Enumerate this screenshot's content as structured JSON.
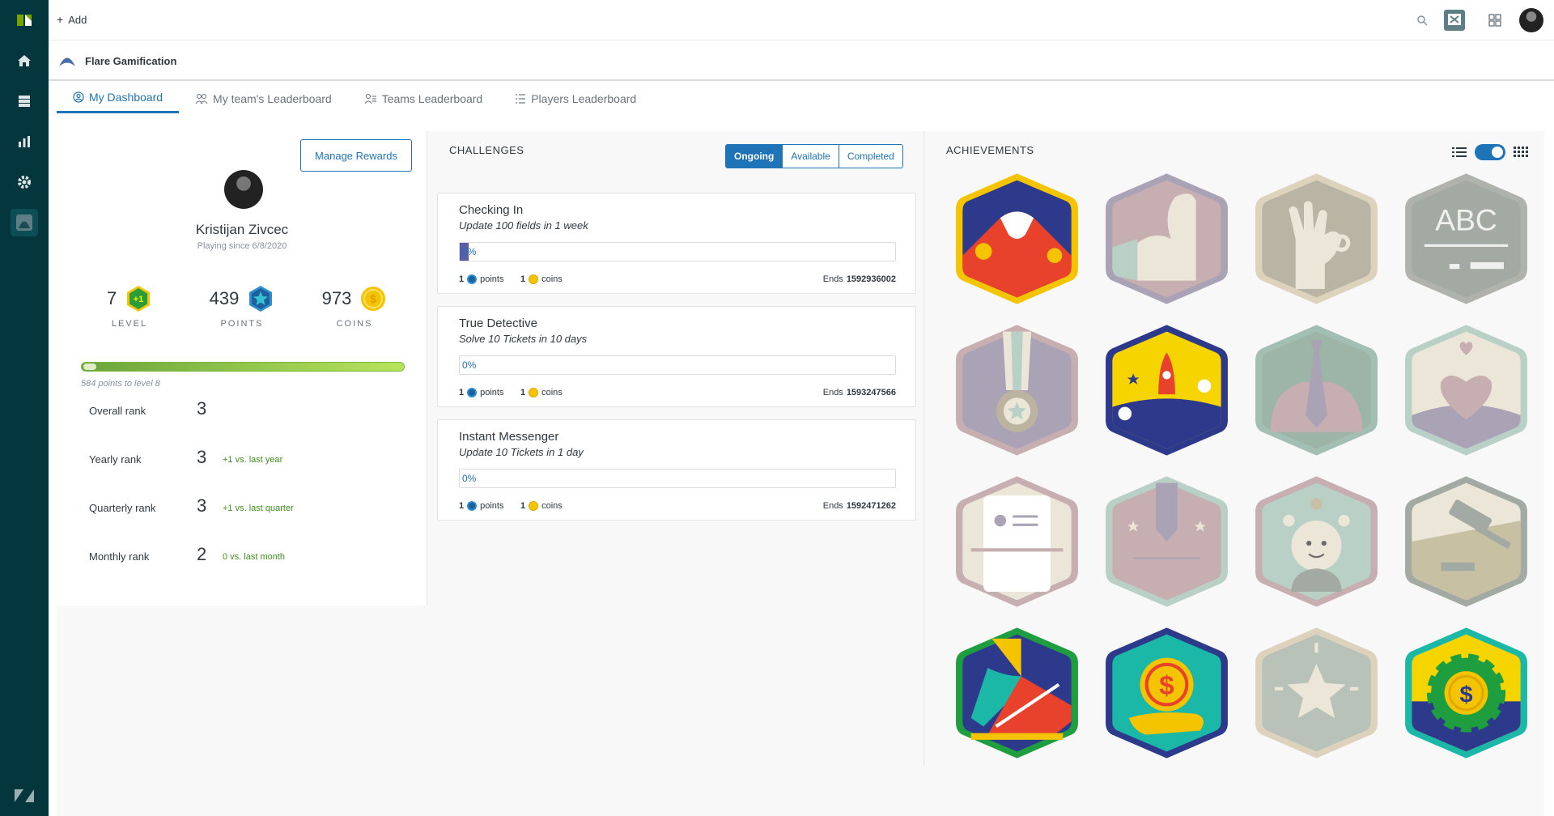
{
  "topbar": {
    "add_label": "Add"
  },
  "app": {
    "title": "Flare Gamification"
  },
  "tabs": [
    {
      "label": "My Dashboard"
    },
    {
      "label": "My team's Leaderboard"
    },
    {
      "label": "Teams Leaderboard"
    },
    {
      "label": "Players Leaderboard"
    }
  ],
  "profile": {
    "manage_rewards": "Manage Rewards",
    "name": "Kristijan Zivcec",
    "since": "Playing since 6/8/2020",
    "level": {
      "value": "7",
      "badge": "+1",
      "label": "LEVEL"
    },
    "points": {
      "value": "439",
      "label": "POINTS"
    },
    "coins": {
      "value": "973",
      "badge": "$",
      "label": "COINS"
    },
    "progress_text": "584 points to level 8",
    "progress_fraction": 0.04,
    "ranks": [
      {
        "label": "Overall rank",
        "value": "3",
        "delta": ""
      },
      {
        "label": "Yearly rank",
        "value": "3",
        "delta": "+1 vs. last year"
      },
      {
        "label": "Quarterly rank",
        "value": "3",
        "delta": "+1 vs. last quarter"
      },
      {
        "label": "Monthly rank",
        "value": "2",
        "delta": "0 vs. last month"
      }
    ]
  },
  "challenges": {
    "title": "CHALLENGES",
    "filters": [
      "Ongoing",
      "Available",
      "Completed"
    ],
    "active_filter": "Ongoing",
    "items": [
      {
        "title": "Checking In",
        "subtitle": "Update 100 fields in 1 week",
        "progress": "0%",
        "fill": 0.02,
        "points": "1",
        "points_label": "points",
        "coins": "1",
        "coins_label": "coins",
        "ends_label": "Ends",
        "ends": "1592936002"
      },
      {
        "title": "True Detective",
        "subtitle": "Solve 10 Tickets in 10 days",
        "progress": "0%",
        "fill": 0,
        "points": "1",
        "points_label": "points",
        "coins": "1",
        "coins_label": "coins",
        "ends_label": "Ends",
        "ends": "1593247566"
      },
      {
        "title": "Instant Messenger",
        "subtitle": "Update 10 Tickets in 1 day",
        "progress": "0%",
        "fill": 0,
        "points": "1",
        "points_label": "points",
        "coins": "1",
        "coins_label": "coins",
        "ends_label": "Ends",
        "ends": "1592471262"
      }
    ]
  },
  "achievements": {
    "title": "ACHIEVEMENTS",
    "badges": [
      {
        "name": "mountain-badge",
        "earned": true
      },
      {
        "name": "muscle-badge",
        "earned": false
      },
      {
        "name": "ok-hand-badge",
        "earned": false
      },
      {
        "name": "abc-board-badge",
        "earned": false,
        "text": "ABC"
      },
      {
        "name": "medal-badge",
        "earned": false
      },
      {
        "name": "rocket-badge",
        "earned": true
      },
      {
        "name": "tie-badge",
        "earned": false
      },
      {
        "name": "heart-badge",
        "earned": false
      },
      {
        "name": "robot-badge",
        "earned": false
      },
      {
        "name": "pencil-badge",
        "earned": false
      },
      {
        "name": "baby-badge",
        "earned": false
      },
      {
        "name": "gavel-badge",
        "earned": false
      },
      {
        "name": "sneaker-badge",
        "earned": true
      },
      {
        "name": "coin-hand-badge",
        "earned": true
      },
      {
        "name": "star-badge",
        "earned": false
      },
      {
        "name": "gear-coin-badge",
        "earned": true
      }
    ]
  }
}
